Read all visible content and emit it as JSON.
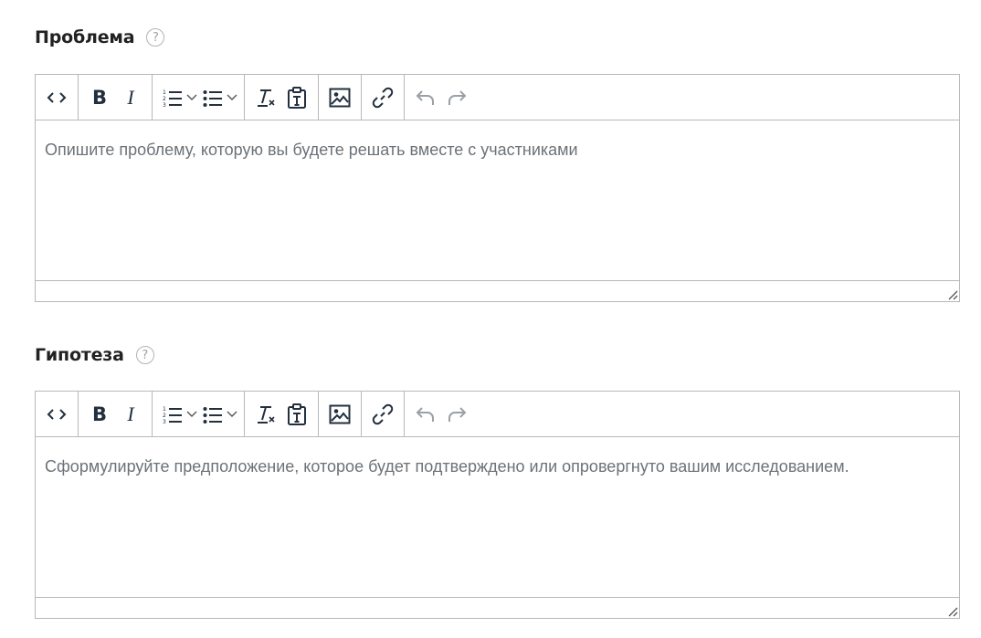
{
  "fields": [
    {
      "label": "Проблема",
      "help_glyph": "?",
      "placeholder": "Опишите проблему, которую вы будете решать вместе с участниками"
    },
    {
      "label": "Гипотеза",
      "help_glyph": "?",
      "placeholder": "Сформулируйте предположение, которое будет подтверждено или опровергнуто вашим исследованием."
    }
  ],
  "toolbar": {
    "bold_label": "B",
    "italic_label": "I",
    "icons": [
      "source-code-icon",
      "bold-icon",
      "italic-icon",
      "numbered-list-icon",
      "chevron-down-icon",
      "bullet-list-icon",
      "chevron-down-icon",
      "clear-formatting-icon",
      "paste-as-text-icon",
      "image-icon",
      "link-icon",
      "undo-icon",
      "redo-icon"
    ]
  },
  "colors": {
    "border": "#b8b8b8",
    "icon": "#222f3e",
    "icon_disabled": "#9aa0a6",
    "placeholder": "#6c7278",
    "label": "#222222"
  }
}
